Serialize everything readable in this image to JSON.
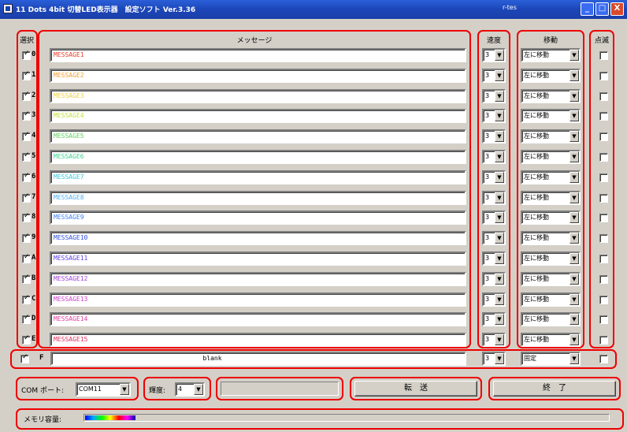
{
  "window": {
    "title": "11 Dots 4bit 切替LED表示器　設定ソフト Ver.3.36",
    "right_label": "r-tes",
    "buttons": [
      "_",
      "□",
      "X"
    ]
  },
  "columns": {
    "select": "選択",
    "message": "メッセージ",
    "speed": "速度",
    "move": "移動",
    "blink": "点滅"
  },
  "rows": [
    {
      "hex": "0",
      "message": "MESSAGE1",
      "color": "#e8402a",
      "checked": true,
      "speed": "3",
      "move": "左に移動",
      "blink": false
    },
    {
      "hex": "1",
      "message": "MESSAGE2",
      "color": "#f0a030",
      "checked": true,
      "speed": "3",
      "move": "左に移動",
      "blink": false
    },
    {
      "hex": "2",
      "message": "MESSAGE3",
      "color": "#f0d040",
      "checked": true,
      "speed": "3",
      "move": "左に移動",
      "blink": false
    },
    {
      "hex": "3",
      "message": "MESSAGE4",
      "color": "#c8e040",
      "checked": true,
      "speed": "3",
      "move": "左に移動",
      "blink": false
    },
    {
      "hex": "4",
      "message": "MESSAGE5",
      "color": "#60d060",
      "checked": true,
      "speed": "3",
      "move": "左に移動",
      "blink": false
    },
    {
      "hex": "5",
      "message": "MESSAGE6",
      "color": "#40d090",
      "checked": true,
      "speed": "3",
      "move": "左に移動",
      "blink": false
    },
    {
      "hex": "6",
      "message": "MESSAGE7",
      "color": "#40c8d8",
      "checked": true,
      "speed": "3",
      "move": "左に移動",
      "blink": false
    },
    {
      "hex": "7",
      "message": "MESSAGE8",
      "color": "#50b0f0",
      "checked": true,
      "speed": "3",
      "move": "左に移動",
      "blink": false
    },
    {
      "hex": "8",
      "message": "MESSAGE9",
      "color": "#4080f0",
      "checked": true,
      "speed": "3",
      "move": "左に移動",
      "blink": false
    },
    {
      "hex": "9",
      "message": "MESSAGE10",
      "color": "#3050e0",
      "checked": true,
      "speed": "3",
      "move": "左に移動",
      "blink": false
    },
    {
      "hex": "A",
      "message": "MESSAGE11",
      "color": "#6040e0",
      "checked": true,
      "speed": "3",
      "move": "左に移動",
      "blink": false
    },
    {
      "hex": "B",
      "message": "MESSAGE12",
      "color": "#a040e0",
      "checked": true,
      "speed": "3",
      "move": "左に移動",
      "blink": false
    },
    {
      "hex": "C",
      "message": "MESSAGE13",
      "color": "#d040d0",
      "checked": true,
      "speed": "3",
      "move": "左に移動",
      "blink": false
    },
    {
      "hex": "D",
      "message": "MESSAGE14",
      "color": "#e040a0",
      "checked": true,
      "speed": "3",
      "move": "左に移動",
      "blink": false
    },
    {
      "hex": "E",
      "message": "MESSAGE15",
      "color": "#e03060",
      "checked": true,
      "speed": "3",
      "move": "左に移動",
      "blink": false
    }
  ],
  "blank_row": {
    "hex": "F",
    "message": "blank",
    "checked": true,
    "speed": "3",
    "move": "固定",
    "blink": false
  },
  "bottom": {
    "com_label": "COM ポート:",
    "com_value": "COM11",
    "brightness_label": "輝度:",
    "brightness_value": "4",
    "transfer_button": "転　送",
    "exit_button": "終　了",
    "memory_label": "メモリ容量:"
  }
}
